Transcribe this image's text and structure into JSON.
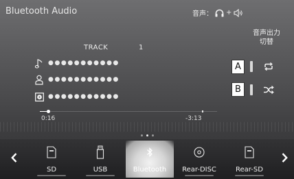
{
  "header": {
    "title": "Bluetooth Audio",
    "audio_output_label": "音声：",
    "plus": "+",
    "headphone_icon": "headphone-icon",
    "speaker_icon": "speaker-icon"
  },
  "switch_output_button": {
    "line1": "音声出力",
    "line2": "切替"
  },
  "track": {
    "label": "TRACK",
    "number": "1"
  },
  "info_rows": [
    {
      "icon": "music-note-icon",
      "value": "●●●●●●●●●●●"
    },
    {
      "icon": "artist-icon",
      "value": "●●●●●●●●●●●"
    },
    {
      "icon": "album-icon",
      "value": "●●●●●●●●●●●"
    }
  ],
  "side_buttons": [
    {
      "name": "repeat-button",
      "icon": "repeat-icon",
      "callout": "A"
    },
    {
      "name": "shuffle-button",
      "icon": "shuffle-icon",
      "callout": "B"
    }
  ],
  "playback": {
    "elapsed": "0:16",
    "remaining": "-3:13",
    "progress_fraction": 0.048
  },
  "page_indicator": {
    "count": 3,
    "active": 1
  },
  "sources": [
    {
      "label": "SD",
      "icon": "sd-card-icon",
      "selected": false
    },
    {
      "label": "USB",
      "icon": "usb-icon",
      "selected": false
    },
    {
      "label": "Bluetooth",
      "icon": "bluetooth-icon",
      "selected": true
    },
    {
      "label": "Rear-DISC",
      "icon": "disc-icon",
      "selected": false
    },
    {
      "label": "Rear-SD",
      "icon": "sd-card-icon",
      "selected": false
    }
  ],
  "nav": {
    "prev_icon": "chevron-left-icon",
    "next_icon": "chevron-right-icon"
  }
}
